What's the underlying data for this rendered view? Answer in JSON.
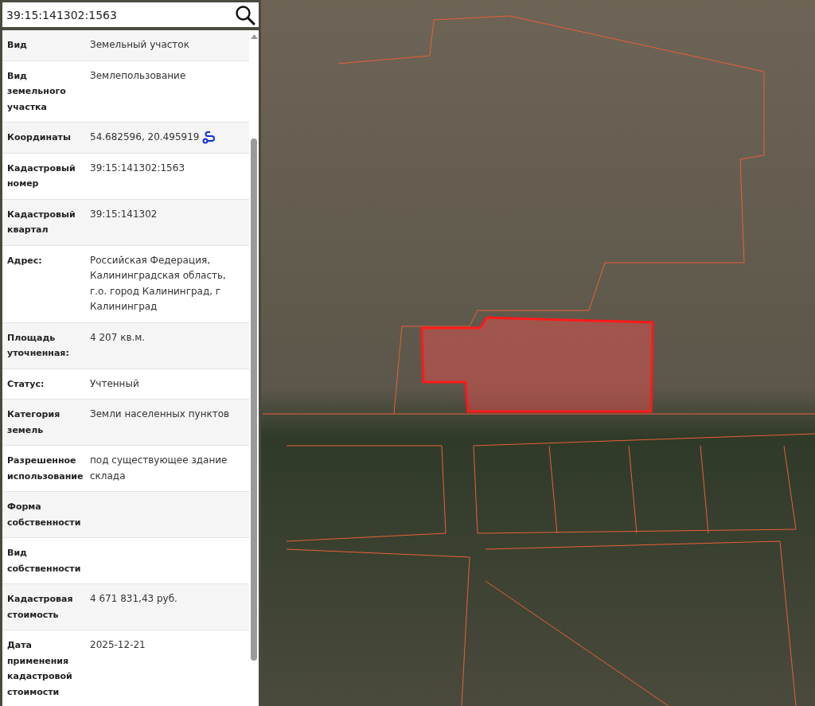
{
  "search": {
    "value": "39:15:141302:1563"
  },
  "rows": [
    {
      "kind": "text",
      "label": "Вид",
      "value": "Земельный участок"
    },
    {
      "kind": "text",
      "label": "Вид земельного участка",
      "value": "Землепользование"
    },
    {
      "kind": "coordinates",
      "label": "Координаты",
      "value": "54.682596, 20.495919"
    },
    {
      "kind": "text",
      "label": "Кадастровый номер",
      "value": "39:15:141302:1563"
    },
    {
      "kind": "text",
      "label": "Кадастровый квартал",
      "value": "39:15:141302"
    },
    {
      "kind": "text",
      "label": "Адрес:",
      "value": "Российская Федерация, Калининградская область, г.о. город Калининград, г Калининград"
    },
    {
      "kind": "text",
      "label": "Площадь уточненная:",
      "value": "4 207 кв.м."
    },
    {
      "kind": "text",
      "label": "Статус:",
      "value": "Учтенный"
    },
    {
      "kind": "text",
      "label": "Категория земель",
      "value": "Земли населенных пунктов"
    },
    {
      "kind": "text",
      "label": "Разрешенное использование",
      "value": "под существующее здание склада"
    },
    {
      "kind": "text",
      "label": "Форма собственности"
    },
    {
      "kind": "text",
      "label": "Вид собственности"
    },
    {
      "kind": "text",
      "label": "Кадастровая стоимость",
      "value": "4 671 831,43 руб."
    },
    {
      "kind": "text",
      "label": "Дата применения кадастровой стоимости",
      "value": "2025-12-21"
    }
  ]
}
